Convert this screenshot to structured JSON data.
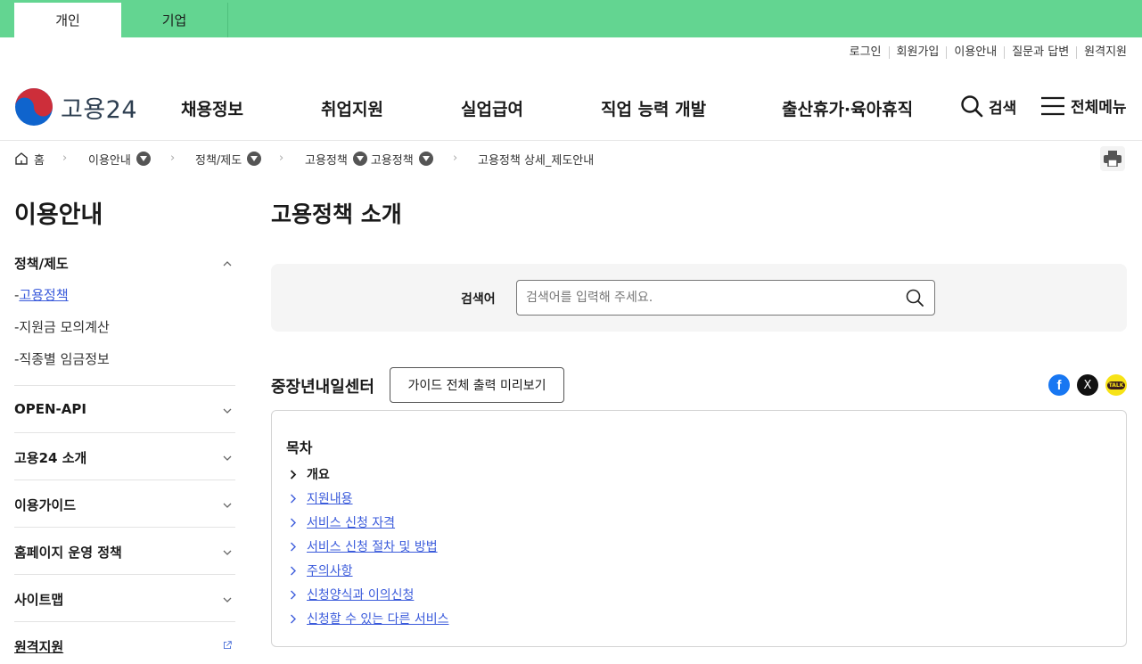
{
  "top_tabs": {
    "personal": "개인",
    "corporate": "기업"
  },
  "util_links": [
    "로그인",
    "회원가입",
    "이용안내",
    "질문과 답변",
    "원격지원"
  ],
  "logo": {
    "text": "고용24"
  },
  "gnb": [
    "채용정보",
    "취업지원",
    "실업급여",
    "직업 능력 개발",
    "출산휴가·육아휴직"
  ],
  "header": {
    "search_label": "검색",
    "menu_label": "전체메뉴"
  },
  "breadcrumb": {
    "home": "홈",
    "items": [
      "이용안내",
      "정책/제도",
      "고용정책",
      "고용정책",
      "고용정책 상세_제도안내"
    ]
  },
  "sidebar": {
    "title": "이용안내",
    "open_section": "정책/제도",
    "sub_items": [
      {
        "label": "고용정책",
        "active": true
      },
      {
        "label": "지원금 모의계산",
        "active": false
      },
      {
        "label": "직종별 임금정보",
        "active": false
      }
    ],
    "sections": [
      "OPEN-API",
      "고용24 소개",
      "이용가이드",
      "홈페이지 운영 정책",
      "사이트맵"
    ],
    "external": "원격지원"
  },
  "main": {
    "title": "고용정책 소개",
    "search": {
      "label": "검색어",
      "placeholder": "검색어를 입력해 주세요."
    },
    "section_title": "중장년내일센터",
    "guide_button": "가이드 전체 출력 미리보기",
    "share": {
      "facebook": "f",
      "x": "X",
      "kakao": "TALK"
    },
    "toc": {
      "title": "목차",
      "items": [
        "개요",
        "지원내용",
        "서비스 신청 자격",
        "서비스 신청 절차 및 방법",
        "주의사항",
        "신청양식과 이의신청",
        "신청할 수 있는 다른 서비스"
      ]
    }
  },
  "colors": {
    "top_bar": "#63d591",
    "link": "#3b5bdb",
    "logo_red": "#cd2e3a",
    "logo_blue": "#0f64cd"
  }
}
